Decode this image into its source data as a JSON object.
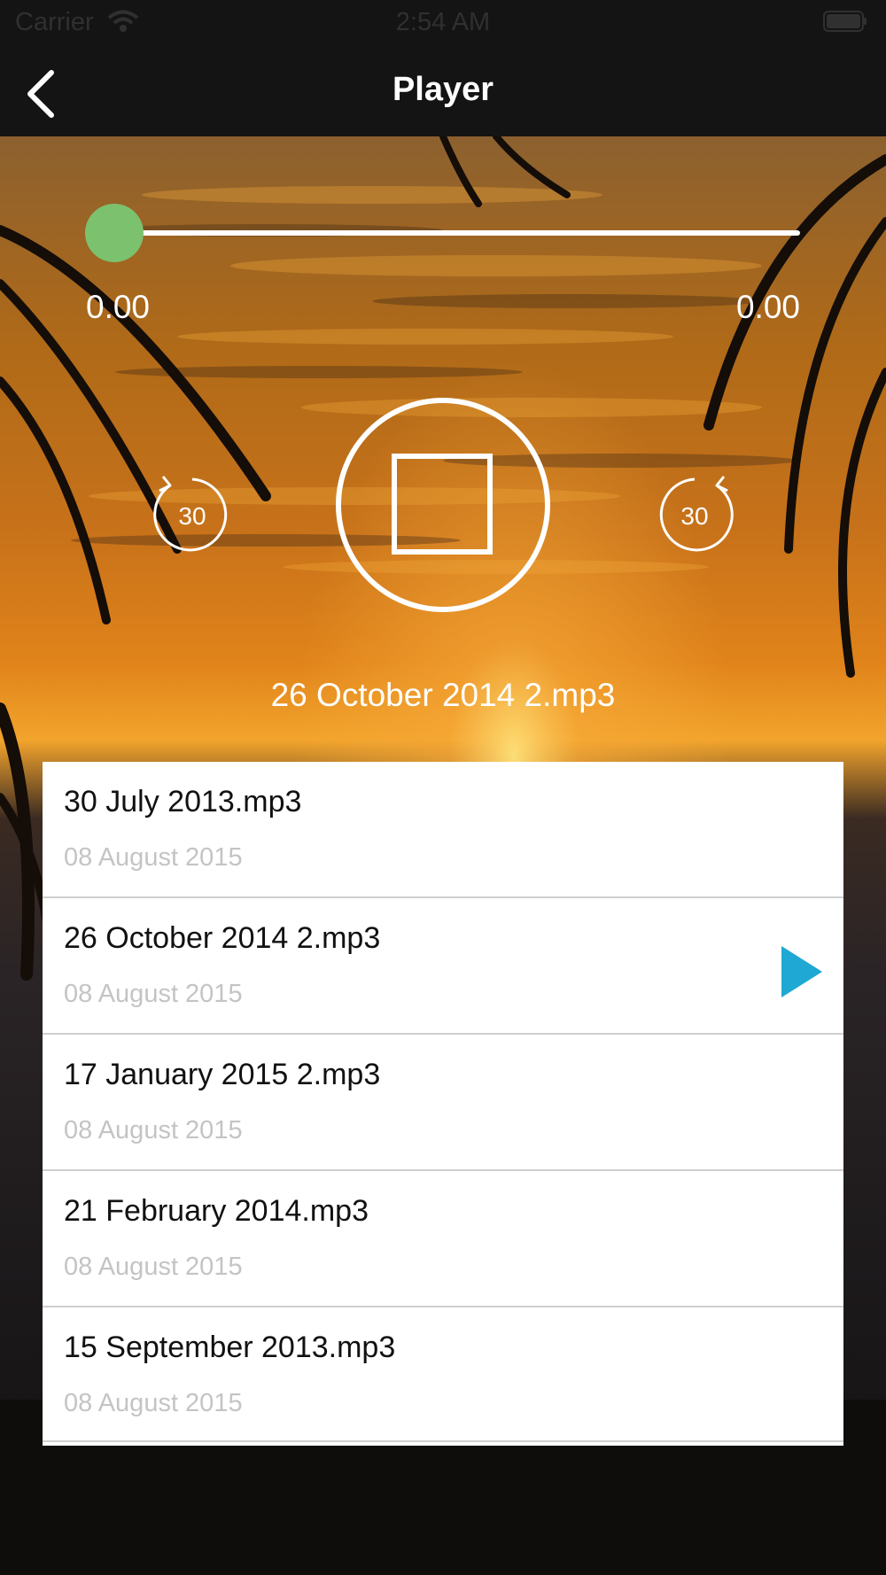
{
  "status_bar": {
    "carrier": "Carrier",
    "time": "2:54 AM",
    "icons": [
      "wifi-icon",
      "battery-icon"
    ]
  },
  "nav": {
    "title": "Player",
    "back_icon": "chevron-left-icon"
  },
  "player": {
    "progress": 0,
    "elapsed": "0.00",
    "duration": "0.00",
    "rewind_label": "30",
    "forward_label": "30",
    "now_playing": "26 October 2014 2.mp3",
    "colors": {
      "slider_thumb": "#7cc16e",
      "accent": "#1fa8d4"
    }
  },
  "list": {
    "items": [
      {
        "title": "30 July 2013.mp3",
        "date": "08 August 2015",
        "playing": false
      },
      {
        "title": "26 October 2014 2.mp3",
        "date": "08 August 2015",
        "playing": true
      },
      {
        "title": "17 January 2015 2.mp3",
        "date": "08 August 2015",
        "playing": false
      },
      {
        "title": "21 February 2014.mp3",
        "date": "08 August 2015",
        "playing": false
      },
      {
        "title": "15 September 2013.mp3",
        "date": "08 August 2015",
        "playing": false
      }
    ]
  }
}
